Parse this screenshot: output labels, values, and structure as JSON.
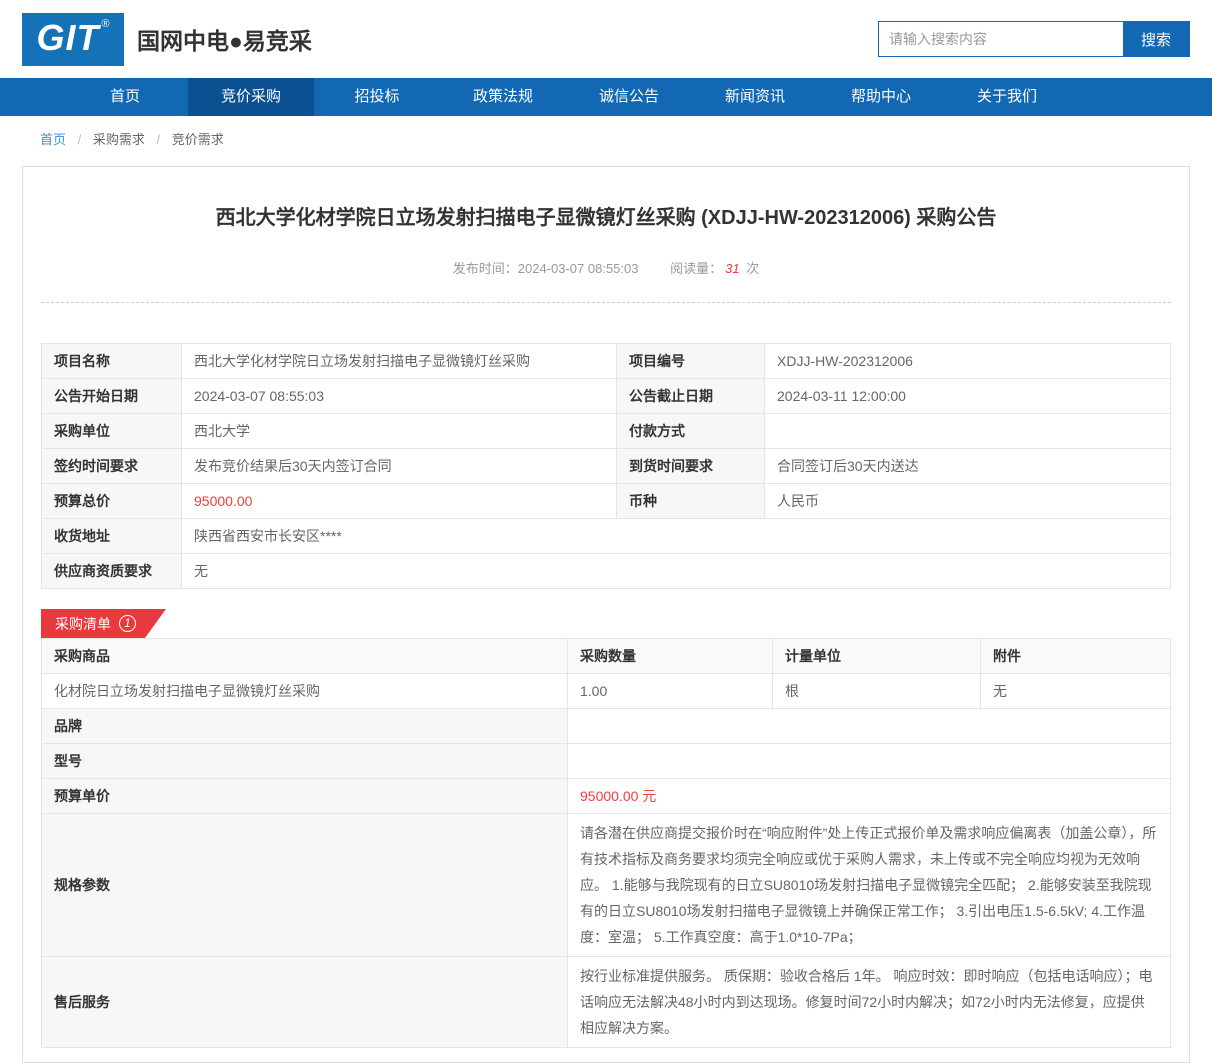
{
  "header": {
    "logo_text": "GIT",
    "logo_reg": "®",
    "site_name": "国网中电●易竞采",
    "search": {
      "placeholder": "请输入搜索内容",
      "button_label": "搜索"
    }
  },
  "nav": {
    "items": [
      {
        "label": "首页",
        "active": false
      },
      {
        "label": "竞价采购",
        "active": true
      },
      {
        "label": "招投标",
        "active": false
      },
      {
        "label": "政策法规",
        "active": false
      },
      {
        "label": "诚信公告",
        "active": false
      },
      {
        "label": "新闻资讯",
        "active": false
      },
      {
        "label": "帮助中心",
        "active": false
      },
      {
        "label": "关于我们",
        "active": false
      }
    ]
  },
  "breadcrumb": {
    "separator": "/",
    "items": [
      "首页",
      "采购需求",
      "竞价需求"
    ]
  },
  "announcement": {
    "title": "西北大学化材学院日立场发射扫描电子显微镜灯丝采购 (XDJJ-HW-202312006) 采购公告",
    "publish_label": "发布时间：",
    "publish_value": "2024-03-07 08:55:03",
    "read_label": "阅读量：",
    "read_value": "31",
    "read_unit": "次"
  },
  "info_table": {
    "rows4": [
      {
        "l1": "项目名称",
        "v1": "西北大学化材学院日立场发射扫描电子显微镜灯丝采购",
        "l2": "项目编号",
        "v2": "XDJJ-HW-202312006"
      },
      {
        "l1": "公告开始日期",
        "v1": "2024-03-07 08:55:03",
        "l2": "公告截止日期",
        "v2": "2024-03-11 12:00:00"
      },
      {
        "l1": "采购单位",
        "v1": "西北大学",
        "l2": "付款方式",
        "v2": ""
      },
      {
        "l1": "签约时间要求",
        "v1": "发布竞价结果后30天内签订合同",
        "l2": "到货时间要求",
        "v2": "合同签订后30天内送达"
      },
      {
        "l1": "预算总价",
        "v1": "95000.00",
        "l2": "币种",
        "v2": "人民币"
      }
    ],
    "rows_full": [
      {
        "label": "收货地址",
        "value": "陕西省西安市长安区****"
      },
      {
        "label": "供应商资质要求",
        "value": "无"
      }
    ]
  },
  "purchase_list": {
    "tab_label": "采购清单",
    "tab_count": "1",
    "columns": [
      "采购商品",
      "采购数量",
      "计量单位",
      "附件"
    ],
    "item": {
      "name": "化材院日立场发射扫描电子显微镜灯丝采购",
      "quantity": "1.00",
      "unit": "根",
      "attachment": "无"
    },
    "details": [
      {
        "label": "品牌",
        "value": ""
      },
      {
        "label": "型号",
        "value": ""
      },
      {
        "label": "预算单价",
        "value": "95000.00 元"
      },
      {
        "label": "规格参数",
        "value": "请各潜在供应商提交报价时在“响应附件”处上传正式报价单及需求响应偏离表（加盖公章），所有技术指标及商务要求均须完全响应或优于采购人需求，未上传或不完全响应均视为无效响应。 1.能够与我院现有的日立SU8010场发射扫描电子显微镜完全匹配； 2.能够安装至我院现有的日立SU8010场发射扫描电子显微镜上并确保正常工作； 3.引出电压1.5-6.5kV; 4.工作温度：室温； 5.工作真空度：高于1.0*10-7Pa；"
      },
      {
        "label": "售后服务",
        "value": "按行业标准提供服务。 质保期：验收合格后 1年。 响应时效：即时响应（包括电话响应）；电话响应无法解决48小时内到达现场。修复时间72小时内解决；如72小时内无法修复，应提供相应解决方案。"
      }
    ]
  },
  "colors": {
    "primary_blue": "#1268b3",
    "nav_active_blue": "#0b5191",
    "logo_blue": "#1472b8",
    "accent_red": "#e83a3e",
    "red_text": "#f43b3d",
    "link_blue": "#3e8ed8"
  }
}
